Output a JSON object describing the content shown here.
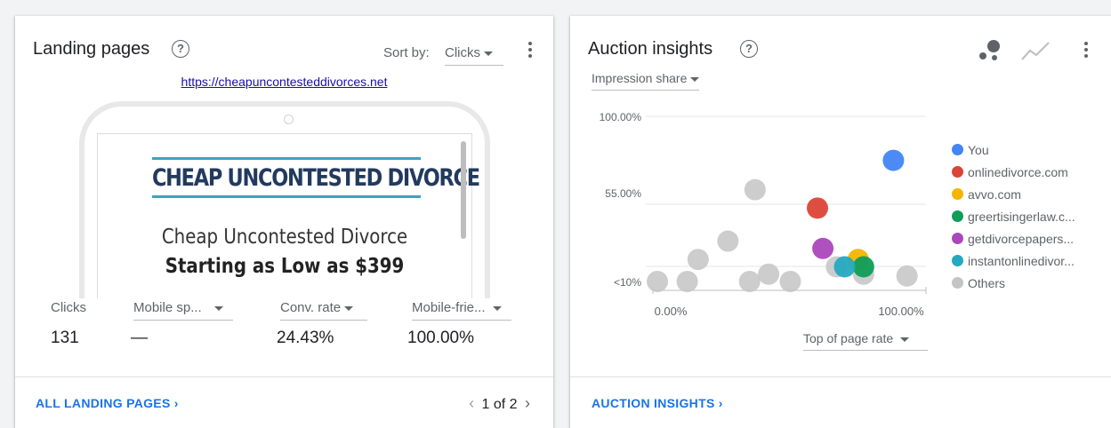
{
  "landing_pages": {
    "title": "Landing pages",
    "sort_label": "Sort by:",
    "sort_value": "Clicks",
    "url": "https://cheapuncontesteddivorces.net",
    "preview": {
      "logo_text": "CHEAP UNCONTESTED DIVORCE",
      "headline": "Cheap Uncontested Divorce",
      "subhead": "Starting as Low as $399"
    },
    "metrics": [
      {
        "label": "Clicks",
        "value": "131",
        "dropdown": false
      },
      {
        "label": "Mobile sp...",
        "value": "—",
        "dropdown": true
      },
      {
        "label": "Conv. rate",
        "value": "24.43%",
        "dropdown": true
      },
      {
        "label": "Mobile-frie...",
        "value": "100.00%",
        "dropdown": true
      }
    ],
    "footer_link": "ALL LANDING PAGES ›",
    "pager": {
      "prev": "‹",
      "text": "1 of 2",
      "next": "›"
    }
  },
  "auction_insights": {
    "title": "Auction insights",
    "metric_select": "Impression share",
    "xaxis_select": "Top of page rate",
    "footer_link": "AUCTION INSIGHTS ›",
    "icons": {
      "bubble": "bubble-chart-icon",
      "trend": "trend-line-icon"
    }
  },
  "chart_data": {
    "type": "scatter",
    "y_ticks": [
      "100.00%",
      "55.00%",
      "<10%"
    ],
    "x_ticks": [
      "0.00%",
      "100.00%"
    ],
    "xlabel": "Top of page rate",
    "ylabel": "Impression share",
    "xlim": [
      0,
      100
    ],
    "ylim": [
      10,
      100
    ],
    "grid": true,
    "legend_position": "right",
    "series": [
      {
        "name": "You",
        "color": "#4285f4",
        "points": [
          [
            88,
            76
          ]
        ]
      },
      {
        "name": "onlinedivorce.com",
        "color": "#db4437",
        "points": [
          [
            60,
            50
          ]
        ]
      },
      {
        "name": "avvo.com",
        "color": "#f4b400",
        "points": [
          [
            75,
            22
          ]
        ]
      },
      {
        "name": "greertisingerlaw.c...",
        "color": "#0f9d58",
        "points": [
          [
            77,
            18
          ]
        ]
      },
      {
        "name": "getdivorcepapers...",
        "color": "#ab47bc",
        "points": [
          [
            62,
            28
          ]
        ]
      },
      {
        "name": "instantonlinedivor...",
        "color": "#24a9c0",
        "points": [
          [
            70,
            18
          ]
        ]
      },
      {
        "name": "Others",
        "color": "#c4c4c4",
        "points": [
          [
            1,
            10
          ],
          [
            12,
            10
          ],
          [
            35,
            10
          ],
          [
            50,
            10
          ],
          [
            16,
            22
          ],
          [
            27,
            32
          ],
          [
            37,
            60
          ],
          [
            42,
            14
          ],
          [
            67,
            18
          ],
          [
            77,
            14
          ],
          [
            93,
            13
          ]
        ]
      }
    ]
  }
}
